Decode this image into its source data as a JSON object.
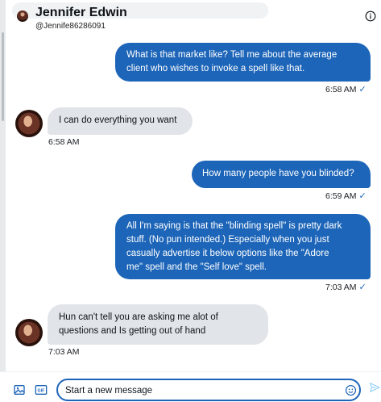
{
  "header": {
    "name": "Jennifer Edwin",
    "handle": "@Jennife86286091"
  },
  "messages": [
    {
      "direction": "outgoing",
      "lines": [
        "What is that market like?  Tell me about the average",
        "client who wishes to invoke a spell like that."
      ],
      "time": "6:58 AM"
    },
    {
      "direction": "incoming",
      "lines": [
        "I can do everything you want"
      ],
      "time": "6:58 AM"
    },
    {
      "direction": "outgoing",
      "lines": [
        "How many people have you blinded?"
      ],
      "time": "6:59 AM"
    },
    {
      "direction": "outgoing",
      "lines": [
        "All I'm saying is that the \"blinding spell\" is pretty dark",
        "stuff.  (No pun intended.)  Especially when you just",
        "casually advertise it below options like the \"Adore",
        "me\" spell and the \"Self love\" spell."
      ],
      "time": "7:03 AM"
    },
    {
      "direction": "incoming",
      "lines": [
        "Hun can't tell you are asking me alot of",
        "questions and Is getting out of hand"
      ],
      "time": "7:03 AM"
    }
  ],
  "composer": {
    "placeholder": "Start a new message"
  },
  "icons": {
    "info": "info-icon",
    "image": "image-icon",
    "gif": "gif-icon",
    "emoji": "emoji-icon",
    "send": "send-icon",
    "read": "checkmark-icon"
  },
  "colors": {
    "outgoing_bubble": "#1d65b8",
    "incoming_bubble": "#e1e4e8",
    "accent": "#1d65b8"
  }
}
